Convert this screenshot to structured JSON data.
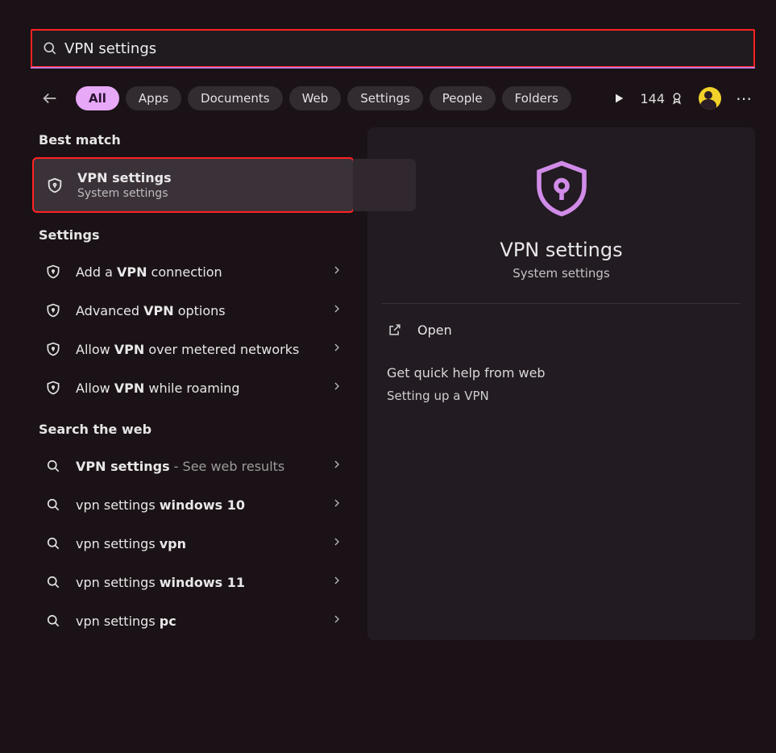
{
  "search": {
    "value": "VPN settings"
  },
  "filters": [
    "All",
    "Apps",
    "Documents",
    "Web",
    "Settings",
    "People",
    "Folders"
  ],
  "active_filter_index": 0,
  "points": "144",
  "left": {
    "best_match_label": "Best match",
    "best_match": {
      "title": "VPN settings",
      "subtitle": "System settings"
    },
    "settings_label": "Settings",
    "settings_items": [
      {
        "pre": "Add a ",
        "bold": "VPN",
        "post": " connection"
      },
      {
        "pre": "Advanced ",
        "bold": "VPN",
        "post": " options"
      },
      {
        "pre": "Allow ",
        "bold": "VPN",
        "post": " over metered networks"
      },
      {
        "pre": "Allow ",
        "bold": "VPN",
        "post": " while roaming"
      }
    ],
    "web_label": "Search the web",
    "web_items": [
      {
        "pre": "",
        "bold": "VPN settings",
        "post_dim": " - See web results"
      },
      {
        "pre": "vpn settings ",
        "bold": "windows 10",
        "post": ""
      },
      {
        "pre": "vpn settings ",
        "bold": "vpn",
        "post": ""
      },
      {
        "pre": "vpn settings ",
        "bold": "windows 11",
        "post": ""
      },
      {
        "pre": "vpn settings ",
        "bold": "pc",
        "post": ""
      }
    ]
  },
  "right": {
    "title": "VPN settings",
    "subtitle": "System settings",
    "open_label": "Open",
    "quick_help_label": "Get quick help from web",
    "quick_links": [
      "Setting up a VPN"
    ]
  }
}
